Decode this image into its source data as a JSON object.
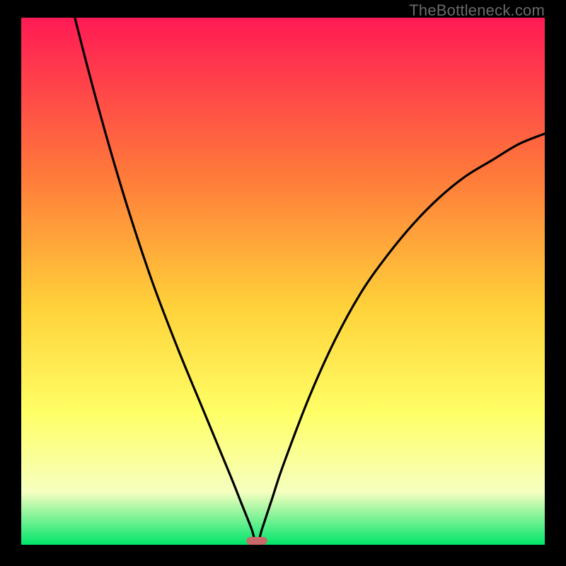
{
  "watermark": "TheBottleneck.com",
  "colors": {
    "frame": "#000000",
    "grad_top": "#ff1a55",
    "grad_mid1": "#ff7a3a",
    "grad_mid2": "#ffd23a",
    "grad_mid3": "#ffff66",
    "grad_low": "#f6ffbf",
    "grad_bottom": "#00e56b",
    "curve": "#000000",
    "marker": "#c86a6a"
  },
  "chart_data": {
    "type": "line",
    "title": "",
    "xlabel": "",
    "ylabel": "",
    "xlim": [
      0,
      100
    ],
    "ylim": [
      0,
      100
    ],
    "marker": {
      "x": 45,
      "y": 0,
      "width": 4,
      "height": 1.5
    },
    "series": [
      {
        "name": "bottleneck-curve",
        "x": [
          0,
          5,
          10,
          15,
          20,
          25,
          30,
          35,
          40,
          42,
          44,
          45,
          46,
          48,
          50,
          55,
          60,
          65,
          70,
          75,
          80,
          85,
          90,
          95,
          100
        ],
        "values": [
          145,
          122,
          101,
          82,
          65,
          50,
          37,
          25,
          13,
          8,
          3,
          0,
          3,
          9,
          15,
          28,
          39,
          48,
          55,
          61,
          66,
          70,
          73,
          76,
          78
        ]
      }
    ],
    "gradient_stops": [
      {
        "offset": 0.0,
        "color": "#ff1a55"
      },
      {
        "offset": 0.3,
        "color": "#ff7a3a"
      },
      {
        "offset": 0.55,
        "color": "#ffd23a"
      },
      {
        "offset": 0.75,
        "color": "#ffff66"
      },
      {
        "offset": 0.9,
        "color": "#f6ffbf"
      },
      {
        "offset": 1.0,
        "color": "#00e56b"
      }
    ]
  }
}
